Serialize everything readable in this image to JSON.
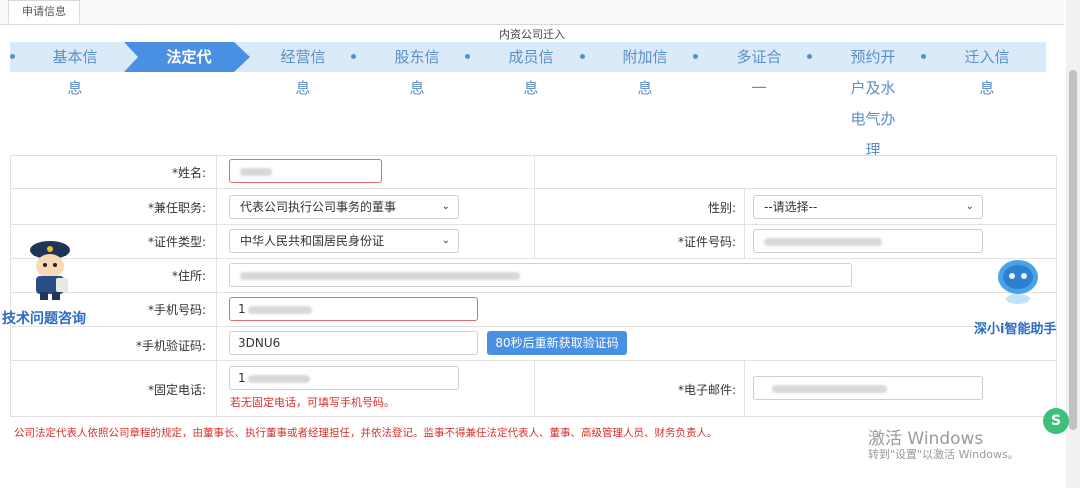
{
  "tabs": [
    {
      "label": "申请信息"
    }
  ],
  "process_title": "内资公司迁入",
  "steps": [
    {
      "lines": [
        "基本信",
        "息"
      ],
      "active": false
    },
    {
      "lines": [
        "法定代",
        ""
      ],
      "active": true
    },
    {
      "lines": [
        "经营信",
        "息"
      ],
      "active": false
    },
    {
      "lines": [
        "股东信",
        "息"
      ],
      "active": false
    },
    {
      "lines": [
        "成员信",
        "息"
      ],
      "active": false
    },
    {
      "lines": [
        "附加信",
        "息"
      ],
      "active": false
    },
    {
      "lines": [
        "多证合",
        "一"
      ],
      "active": false
    },
    {
      "lines": [
        "预约开",
        "户及水",
        "电气办",
        "理"
      ],
      "active": false
    },
    {
      "lines": [
        "迁入信",
        "息"
      ],
      "active": false
    }
  ],
  "form": {
    "name": {
      "label": "*姓名:",
      "value": ""
    },
    "position": {
      "label": "*兼任职务:",
      "value": "代表公司执行公司事务的董事"
    },
    "gender": {
      "label": "性别:",
      "value": "--请选择--"
    },
    "id_type": {
      "label": "*证件类型:",
      "value": "中华人民共和国居民身份证"
    },
    "id_number": {
      "label": "*证件号码:",
      "value": ""
    },
    "address": {
      "label": "*住所:",
      "value": ""
    },
    "mobile": {
      "label": "*手机号码:",
      "value": "1"
    },
    "sms_code": {
      "label": "*手机验证码:",
      "value": "3DNU6",
      "button": "80秒后重新获取验证码"
    },
    "landline": {
      "label": "*固定电话:",
      "value": "1",
      "hint": "若无固定电话，可填写手机号码。"
    },
    "email": {
      "label": "*电子邮件:",
      "value": ""
    }
  },
  "note": "公司法定代表人依照公司章程的规定，由董事长、执行董事或者经理担任，并依法登记。监事不得兼任法定代表人、董事、高级管理人员、财务负责人。",
  "assistants": {
    "tech": "技术问题咨询",
    "robot": "深小i智能助手"
  },
  "watermark": {
    "title": "激活 Windows",
    "subtitle": "转到\"设置\"以激活 Windows。"
  },
  "colors": {
    "step_bg": "#dbeaf8",
    "step_active": "#4a90e2",
    "step_text": "#5b8fc6",
    "error": "#d9302c",
    "button": "#4a90e2"
  }
}
